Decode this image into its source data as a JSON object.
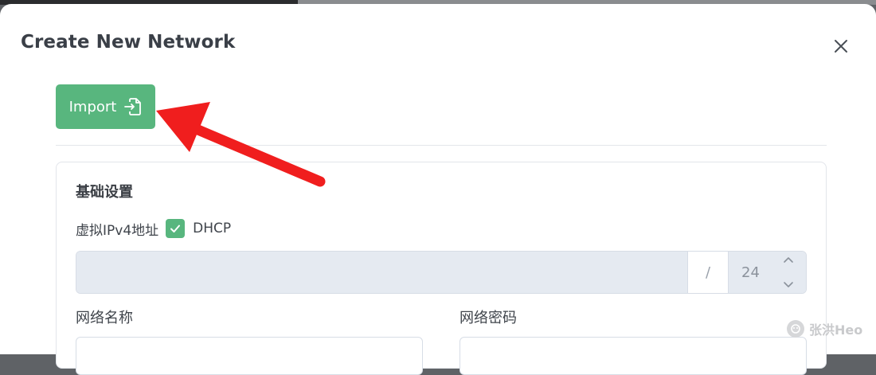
{
  "dialog": {
    "title": "Create New Network",
    "import_label": "Import"
  },
  "basic_settings": {
    "title": "基础设置",
    "ipv4_label": "虚拟IPv4地址",
    "dhcp_label": "DHCP",
    "dhcp_checked": true,
    "ipv4_value": "",
    "slash": "/",
    "prefix_length": "24"
  },
  "fields": {
    "network_name_label": "网络名称",
    "network_name_value": "",
    "network_password_label": "网络密码",
    "network_password_value": ""
  },
  "watermark": "张洪Heo",
  "colors": {
    "accent_green": "#58b67e",
    "annotation_red": "#f01e1e",
    "disabled_input_bg": "#e5eaf1"
  },
  "icons": {
    "close": "close-icon",
    "import": "file-import-icon",
    "checkbox": "check-icon",
    "spinner_up": "chevron-up-icon",
    "spinner_down": "chevron-down-icon"
  }
}
